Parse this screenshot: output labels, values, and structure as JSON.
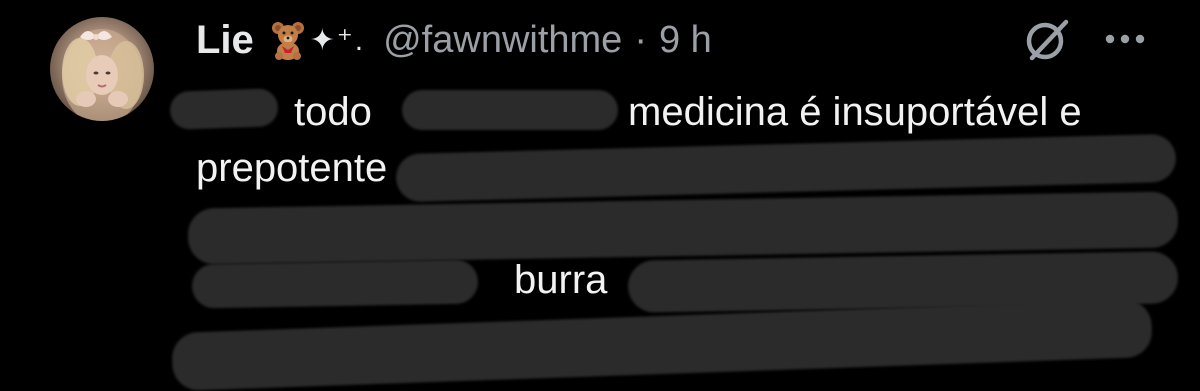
{
  "tweet": {
    "display_name": "Lie",
    "name_emoji": "teddy-bear",
    "name_decoration": "✦⁺.",
    "handle": "@fawnwithme",
    "separator": "·",
    "time": "9 h",
    "text_segments": {
      "line1_a": "todo",
      "line1_b": "medicina é insuportável e",
      "line2_a": "prepotente",
      "line4_a": "burra"
    }
  },
  "icons": {
    "grok": "grok-icon",
    "more": "more-options-icon",
    "avatar": "user-avatar"
  },
  "colors": {
    "background": "#000000",
    "text": "#e7e9ea",
    "secondary": "#9aa0a6",
    "redaction": "#2b2b2b"
  }
}
